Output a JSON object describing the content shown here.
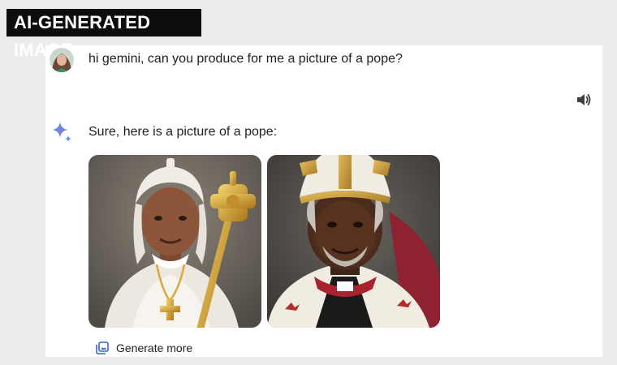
{
  "badge": {
    "text": "AI-GENERATED IMAGE"
  },
  "user_message": {
    "text": "hi gemini, can you produce for me a picture of a pope?"
  },
  "assistant": {
    "reply_text": "Sure, here is a picture of a pope:",
    "generate_more_label": "Generate more"
  },
  "icons": {
    "speaker": "speaker-icon",
    "gemini": "gemini-spark-icon",
    "generate_more": "image-stack-icon"
  },
  "colors": {
    "badge_bg": "#0d0d0d",
    "gemini_blue": "#4a7fe8",
    "text": "#1f1f1f"
  }
}
